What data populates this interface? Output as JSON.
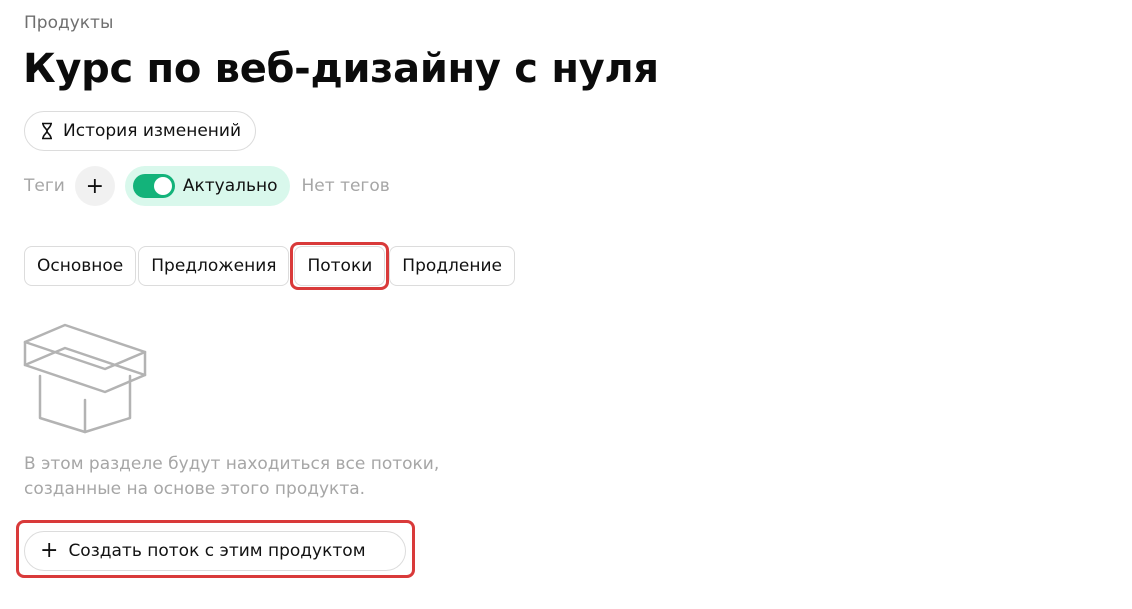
{
  "breadcrumb": "Продукты",
  "page_title": "Курс по веб-дизайну с нуля",
  "history_button": {
    "label": "История изменений",
    "icon": "hourglass-icon"
  },
  "tags": {
    "label": "Теги",
    "add_icon": "plus-icon",
    "add_glyph": "+",
    "status_label": "Актуально",
    "status_on": true,
    "empty_label": "Нет тегов"
  },
  "tabs": [
    {
      "label": "Основное",
      "active": false
    },
    {
      "label": "Предложения",
      "active": false
    },
    {
      "label": "Потоки",
      "active": true
    },
    {
      "label": "Продление",
      "active": false
    }
  ],
  "empty_state": {
    "icon": "empty-box-icon",
    "text_line1": "В этом разделе будут находиться все потоки,",
    "text_line2": "созданные на основе этого продукта."
  },
  "create_button": {
    "label": "Создать поток с этим продуктом",
    "glyph": "+",
    "icon": "plus-icon"
  },
  "colors": {
    "accent_green": "#13b37a",
    "status_bg": "#d9f8ec",
    "highlight_red": "#d93a3a",
    "muted_text": "#a6a6a6"
  }
}
